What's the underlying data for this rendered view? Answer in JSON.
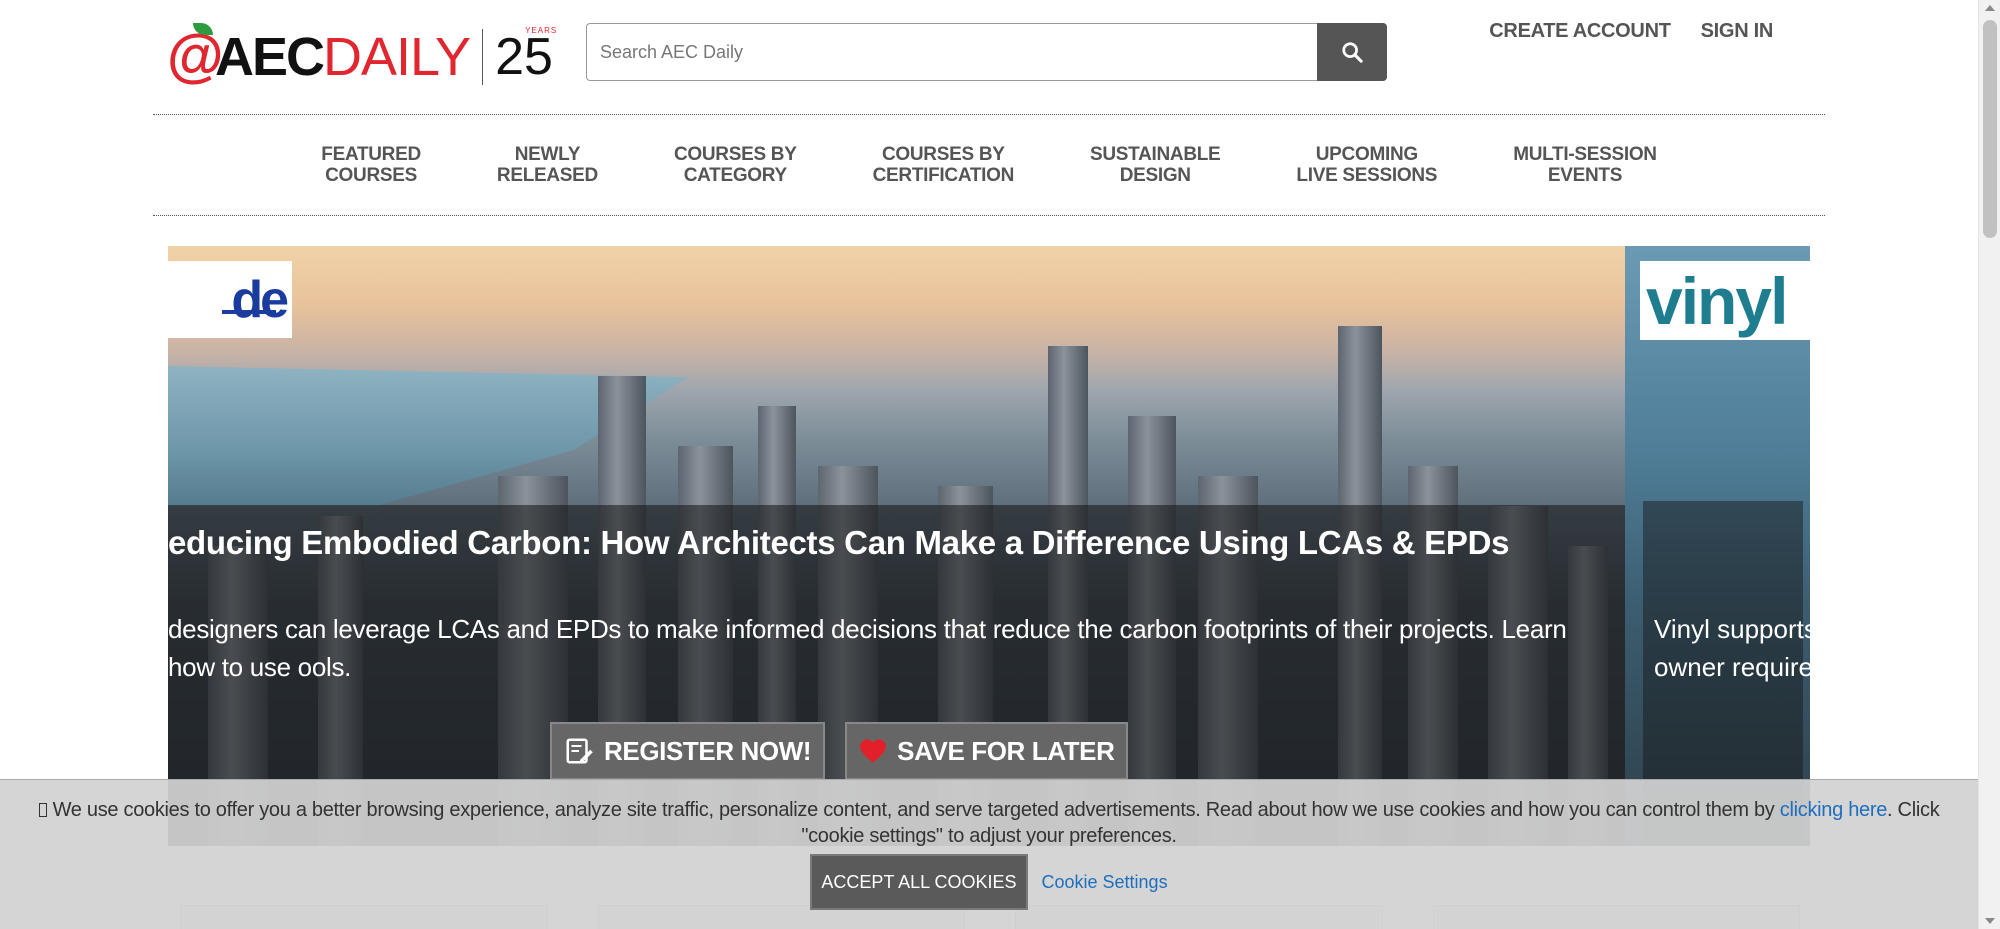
{
  "header": {
    "logo": {
      "at": "@",
      "aec": "AEC",
      "daily": "DAILY",
      "anniversary": "25",
      "years_label": "YEARS"
    },
    "search": {
      "placeholder": "Search AEC Daily",
      "value": "",
      "button_icon": "search-icon"
    },
    "account": {
      "create": "CREATE ACCOUNT",
      "signin": "SIGN IN"
    }
  },
  "nav": {
    "items": [
      {
        "label": "FEATURED\nCOURSES"
      },
      {
        "label": "NEWLY\nRELEASED"
      },
      {
        "label": "COURSES BY\nCATEGORY"
      },
      {
        "label": "COURSES BY\nCERTIFICATION"
      },
      {
        "label": "SUSTAINABLE\nDESIGN"
      },
      {
        "label": "UPCOMING\nLIVE SESSIONS"
      },
      {
        "label": "MULTI-SESSION\nEVENTS"
      }
    ]
  },
  "hero": {
    "current": {
      "badge_text": "de",
      "title": "educing Embodied Carbon: How Architects Can Make a Difference Using LCAs & EPDs",
      "description": "designers can leverage LCAs and EPDs to make informed decisions that reduce the carbon footprints of their projects. Learn how to use ools.",
      "register_label": "REGISTER NOW!",
      "register_icon": "register-icon",
      "save_label": "SAVE FOR LATER",
      "save_icon": "heart-icon"
    },
    "next": {
      "badge_text": "vinyl",
      "description_line1": "Vinyl supports",
      "description_line2": "owner requiren"
    }
  },
  "cookie": {
    "text_before": "We use cookies to offer you a better browsing experience, analyze site traffic, personalize content, and serve targeted advertisements. Read about how we use cookies and how you can control them by ",
    "link_text": "clicking here",
    "text_after": ". Click \"cookie settings\" to adjust your preferences.",
    "accept_label": "ACCEPT ALL COOKIES",
    "settings_label": "Cookie Settings"
  },
  "colors": {
    "brand_red": "#e0262f",
    "brand_green": "#2e9b3e",
    "link_blue": "#1f6ebd",
    "heart_red": "#e3202a",
    "button_gray": "#666666"
  }
}
